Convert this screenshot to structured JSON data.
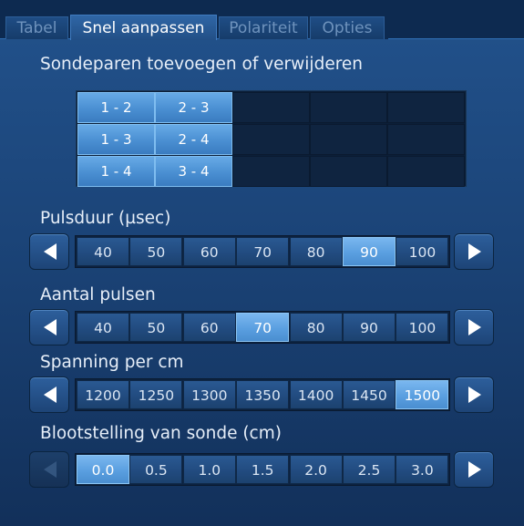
{
  "tabs": [
    {
      "label": "Tabel"
    },
    {
      "label": "Snel aanpassen"
    },
    {
      "label": "Polariteit"
    },
    {
      "label": "Opties"
    }
  ],
  "pairs_section": {
    "title": "Sondeparen toevoegen of verwijderen",
    "pairs": [
      {
        "label": "1 - 2"
      },
      {
        "label": "2 - 3"
      },
      {
        "label": "1 - 3"
      },
      {
        "label": "2 - 4"
      },
      {
        "label": "1 - 4"
      },
      {
        "label": "3 - 4"
      }
    ]
  },
  "pulse_duration": {
    "title": "Pulsduur (µsec)",
    "values": [
      "40",
      "50",
      "60",
      "70",
      "80",
      "90",
      "100"
    ],
    "selected": "90"
  },
  "pulse_count": {
    "title": "Aantal pulsen",
    "values": [
      "40",
      "50",
      "60",
      "70",
      "80",
      "90",
      "100"
    ],
    "selected": "70"
  },
  "voltage": {
    "title": "Spanning per cm",
    "values": [
      "1200",
      "1250",
      "1300",
      "1350",
      "1400",
      "1450",
      "1500"
    ],
    "selected": "1500"
  },
  "exposure": {
    "title": "Blootstelling van sonde (cm)",
    "values": [
      "0.0",
      "0.5",
      "1.0",
      "1.5",
      "2.0",
      "2.5",
      "3.0"
    ],
    "selected": "0.0"
  }
}
